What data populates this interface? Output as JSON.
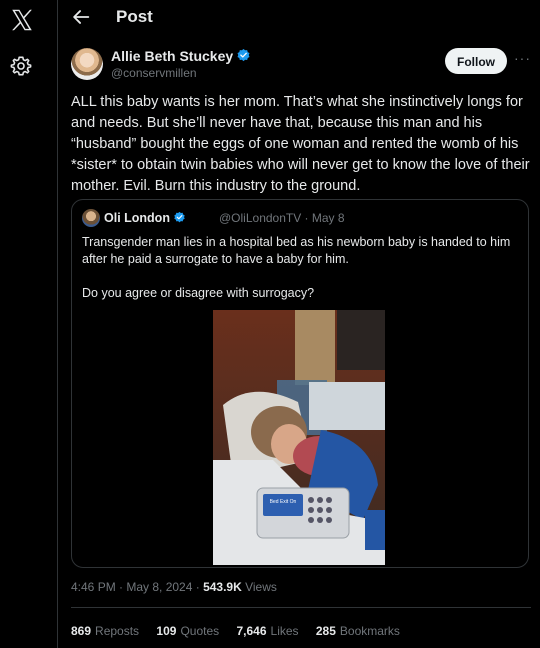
{
  "header": {
    "title": "Post"
  },
  "author": {
    "name": "Allie Beth Stuckey",
    "handle": "@conservmillen",
    "follow_label": "Follow",
    "more_label": "···"
  },
  "tweet": {
    "text": "ALL this baby wants is her mom. That’s what she instinctively longs for and needs. But she’ll never have that, because this man and his “husband” bought the eggs of one woman and rented the womb of his *sister* to obtain twin babies who will never get to know the love of their mother. Evil. Burn this industry to the ground."
  },
  "quote": {
    "name": "Oli London",
    "handle_date": "@OliLondonTV · May 8",
    "text_1": "Transgender man lies in a hospital bed as his newborn baby is handed to him after he paid a surrogate to have a baby for him.",
    "text_2": "Do you agree or disagree with surrogacy?",
    "monitor_text": "Bed Exit On"
  },
  "meta": {
    "timestamp": "4:46 PM · May 8, 2024 · ",
    "views_count": "543.9K",
    "views_label": " Views"
  },
  "stats": {
    "reposts_count": "869",
    "reposts_label": "Reposts",
    "quotes_count": "109",
    "quotes_label": "Quotes",
    "likes_count": "7,646",
    "likes_label": "Likes",
    "bookmarks_count": "285",
    "bookmarks_label": "Bookmarks"
  },
  "colors": {
    "verified": "#1d9bf0",
    "background": "#000000",
    "text": "#e7e9ea",
    "muted": "#71767b",
    "border": "#2f3336"
  }
}
